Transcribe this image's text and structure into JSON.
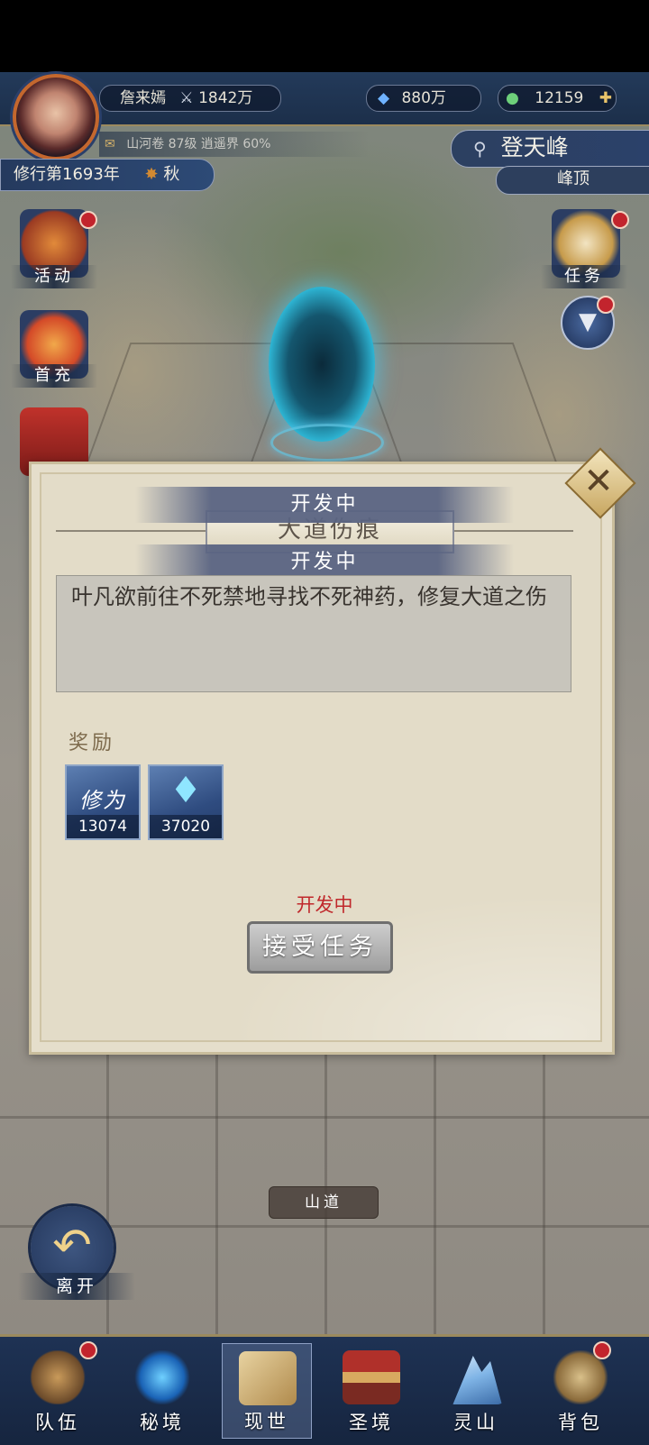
{
  "player": {
    "name": "詹来嫣",
    "power": "1842万",
    "spirit_stones": "880万",
    "jade": "12159",
    "sub_info": "山河卷 87级 逍遥界 60%",
    "cultivation_year": "修行第1693年",
    "season": "秋"
  },
  "location": {
    "title": "登天峰",
    "sub": "峰顶"
  },
  "side_left": [
    {
      "label": "活动",
      "icon": "lantern-icon"
    },
    {
      "label": "首充",
      "icon": "gift-pouch-icon"
    }
  ],
  "side_right": [
    {
      "label": "任务",
      "icon": "scroll-icon"
    }
  ],
  "dialog": {
    "band_top": "开发中",
    "title": "大道伤痕",
    "band_mid": "开发中",
    "description": "叶凡欲前往不死禁地寻找不死神药，修复大道之伤",
    "reward_label": "奖励",
    "rewards": [
      {
        "name": "修为",
        "amount": "13074"
      },
      {
        "icon": "blue-crystal-icon",
        "amount": "37020"
      }
    ],
    "status": "开发中",
    "accept_label": "接受任务"
  },
  "path_label": "山道",
  "back_label": "离开",
  "nav": [
    {
      "label": "队伍",
      "icon": "team-hat-icon"
    },
    {
      "label": "秘境",
      "icon": "vortex-icon"
    },
    {
      "label": "现世",
      "icon": "map-scroll-icon"
    },
    {
      "label": "圣境",
      "icon": "temple-icon"
    },
    {
      "label": "灵山",
      "icon": "mountain-icon"
    },
    {
      "label": "背包",
      "icon": "bag-icon"
    }
  ],
  "colors": {
    "status_red": "#c0282b",
    "notify_dot": "#c2242d",
    "topbar": "#233a5a"
  }
}
